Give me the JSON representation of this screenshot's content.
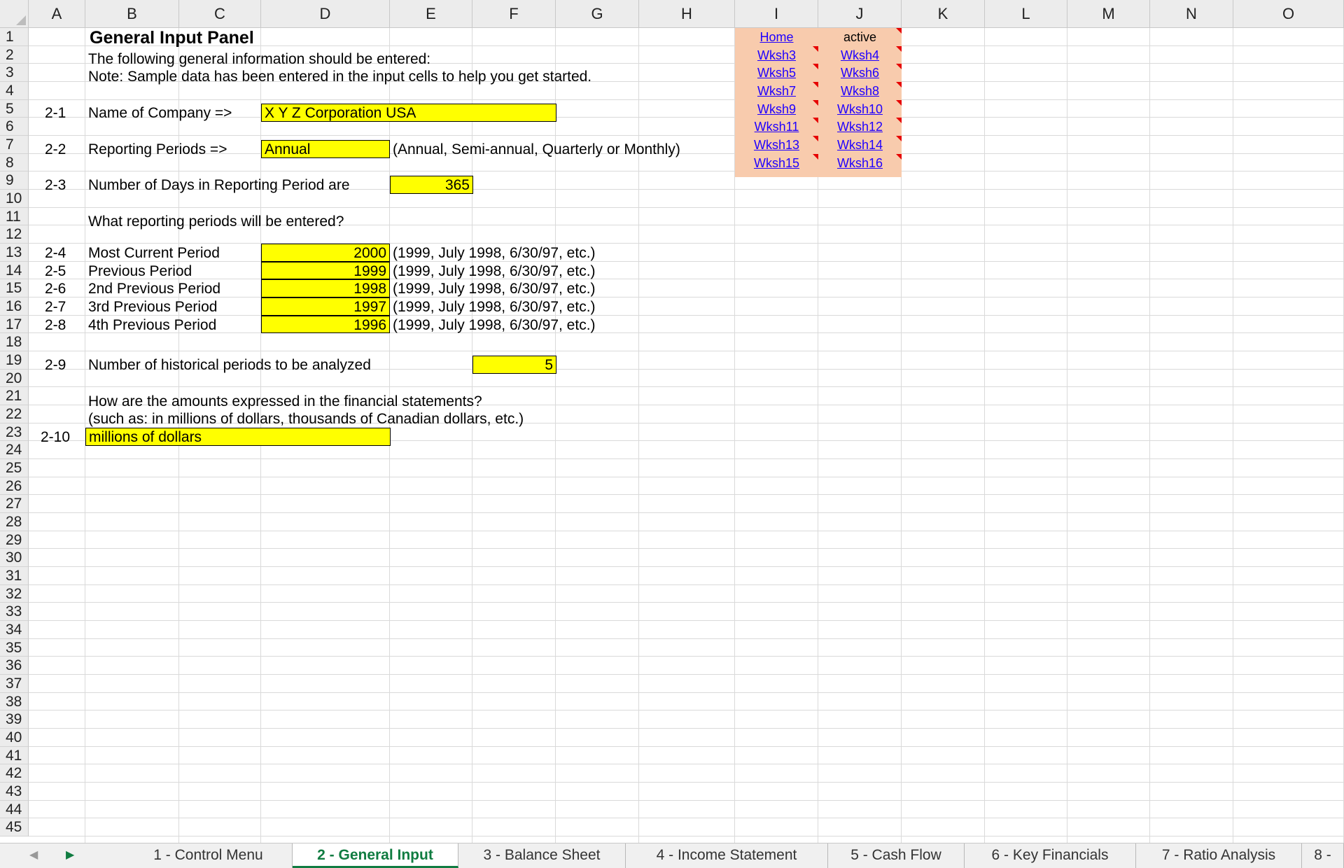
{
  "columns": [
    "A",
    "B",
    "C",
    "D",
    "E",
    "F",
    "G",
    "H",
    "I",
    "J",
    "K",
    "L",
    "M",
    "N",
    "O"
  ],
  "rows": [
    "1",
    "2",
    "3",
    "4",
    "5",
    "6",
    "7",
    "8",
    "9",
    "10",
    "11",
    "12",
    "13",
    "14",
    "15",
    "16",
    "17",
    "18",
    "19",
    "20",
    "21",
    "22",
    "23",
    "24",
    "25",
    "26",
    "27",
    "28",
    "29",
    "30",
    "31",
    "32",
    "33",
    "34",
    "35",
    "36",
    "37",
    "38",
    "39",
    "40",
    "41",
    "42",
    "43",
    "44",
    "45"
  ],
  "panel": {
    "title": "General Input Panel",
    "intro1": "The following general information should be entered:",
    "intro2": "Note: Sample data has been entered in the input cells to help you get started."
  },
  "items": {
    "company": {
      "id": "2-1",
      "label": "Name of Company =>",
      "value": "X Y Z Corporation USA"
    },
    "periods": {
      "id": "2-2",
      "label": "Reporting Periods =>",
      "value": "Annual",
      "hint": "(Annual, Semi-annual, Quarterly or Monthly)"
    },
    "days": {
      "id": "2-3",
      "label": "Number of Days in Reporting Period are",
      "value": "365"
    },
    "question": "What reporting periods will be entered?",
    "period_rows": [
      {
        "id": "2-4",
        "label": "Most Current Period",
        "value": "2000",
        "hint": "(1999, July 1998, 6/30/97, etc.)"
      },
      {
        "id": "2-5",
        "label": "Previous Period",
        "value": "1999",
        "hint": "(1999, July 1998, 6/30/97, etc.)"
      },
      {
        "id": "2-6",
        "label": "2nd Previous Period",
        "value": "1998",
        "hint": "(1999, July 1998, 6/30/97, etc.)"
      },
      {
        "id": "2-7",
        "label": "3rd Previous Period",
        "value": "1997",
        "hint": "(1999, July 1998, 6/30/97, etc.)"
      },
      {
        "id": "2-8",
        "label": "4th Previous Period",
        "value": "1996",
        "hint": "(1999, July 1998, 6/30/97, etc.)"
      }
    ],
    "historical": {
      "id": "2-9",
      "label": "Number of historical periods to be analyzed",
      "value": "5"
    },
    "amounts_q1": "How are the amounts expressed in the financial statements?",
    "amounts_q2": "(such as: in millions of dollars, thousands of Canadian dollars, etc.)",
    "amounts": {
      "id": "2-10",
      "value": "millions of dollars"
    }
  },
  "nav_links": {
    "left": [
      "Home",
      "Wksh3",
      "Wksh5",
      "Wksh7",
      "Wksh9",
      "Wksh11",
      "Wksh13",
      "Wksh15"
    ],
    "right": [
      "active",
      "Wksh4",
      "Wksh6",
      "Wksh8",
      "Wksh10",
      "Wksh12",
      "Wksh14",
      "Wksh16"
    ]
  },
  "tabs": [
    {
      "label": "1 - Control Menu"
    },
    {
      "label": "2 - General Input",
      "active": true
    },
    {
      "label": "3 - Balance Sheet"
    },
    {
      "label": "4 - Income Statement"
    },
    {
      "label": "5 - Cash Flow"
    },
    {
      "label": "6 - Key Financials"
    },
    {
      "label": "7 - Ratio Analysis"
    },
    {
      "label": "8 -"
    }
  ],
  "colors": {
    "input": "#ffff00",
    "nav_bg": "#f8cbad",
    "link": "#1f00ff",
    "active_tab": "#107c41"
  }
}
